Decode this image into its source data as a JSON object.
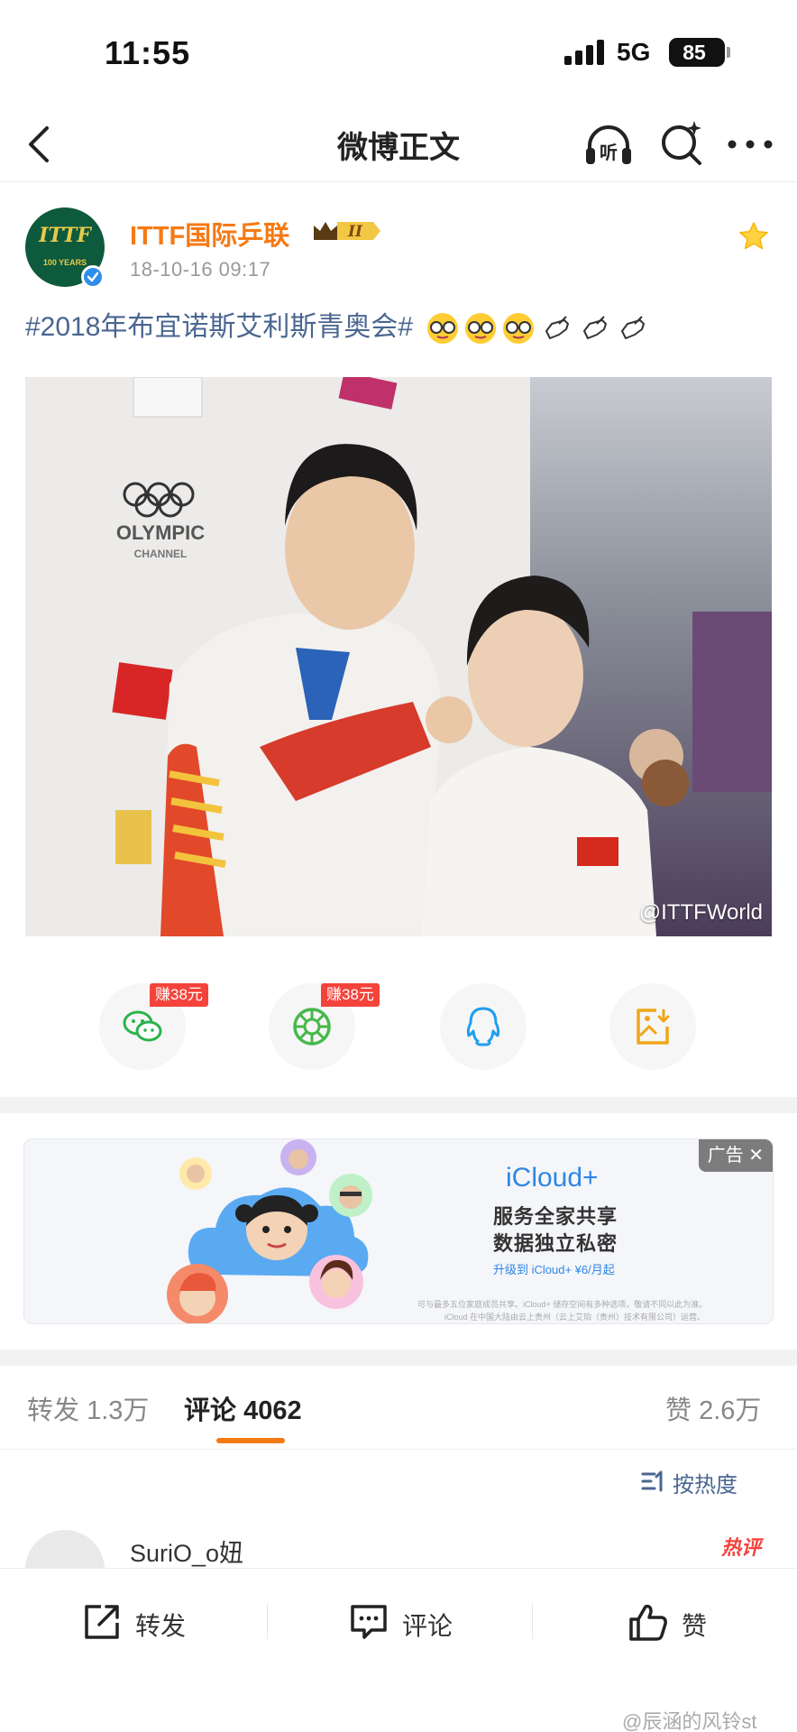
{
  "status": {
    "time": "11:55",
    "network": "5G",
    "battery": "85"
  },
  "nav": {
    "title": "微博正文",
    "listen_icon_text": "听"
  },
  "post": {
    "author": "ITTF国际乒联",
    "avatar_text": "ITTF",
    "avatar_subtext": "100 YEARS",
    "vip_level": "II",
    "time": "18-10-16 09:17",
    "text": "#2018年布宜诺斯艾利斯青奥会#",
    "photo_text": {
      "olympic": "OLYMPIC",
      "channel": "CHANNEL"
    },
    "watermark": "@ITTFWorld"
  },
  "share": {
    "earn_label": "赚38元",
    "targets": [
      "wechat-icon",
      "moments-icon",
      "qq-icon",
      "save-image-icon"
    ]
  },
  "ad": {
    "tag": "广告",
    "title": "iCloud+",
    "line1": "服务全家共享",
    "line2": "数据独立私密",
    "price": "升级到 iCloud+ ¥6/月起",
    "small1": "可与最多五位家庭成员共享。iCloud+ 储存空间有多种选项，敬请不同以此为准。",
    "small2": "iCloud 在中国大陆由云上贵州（云上艾珀（贵州）技术有限公司）运营。"
  },
  "stats": {
    "repost_label": "转发",
    "repost_count": "1.3万",
    "comment_label": "评论",
    "comment_count": "4062",
    "like_label": "赞",
    "like_count": "2.6万"
  },
  "sort": {
    "label": "按热度"
  },
  "comment": {
    "name": "SuriO_o妞",
    "badge": "热评"
  },
  "bottom_bar": {
    "repost": "转发",
    "comment": "评论",
    "like": "赞",
    "watermark": "@辰涵的风铃st"
  },
  "colors": {
    "accent": "#f57a14",
    "link": "#4a6690",
    "verified": "#2f8ee9",
    "earn": "#f4433b"
  }
}
